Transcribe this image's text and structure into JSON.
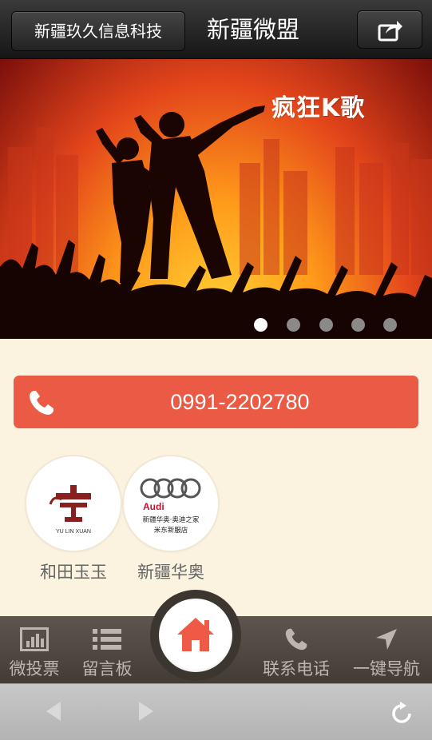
{
  "header": {
    "back_label": "新疆玖久信息科技",
    "title": "新疆微盟"
  },
  "banner": {
    "logo_text": "疯狂K歌",
    "slide_count": 5,
    "active_slide": 1
  },
  "contact": {
    "phone": "0991-2202780"
  },
  "partners": [
    {
      "name": "和田玉玉",
      "logo_caption": "YU LIN XUAN"
    },
    {
      "name": "新疆华奥",
      "logo_brand": "Audi",
      "logo_caption_1": "新疆华奥·奥迪之家",
      "logo_caption_2": "米东新服店"
    }
  ],
  "bottom_nav": {
    "items": [
      {
        "label": "微投票",
        "icon": "chart-icon"
      },
      {
        "label": "留言板",
        "icon": "list-icon"
      },
      {
        "label": "联系电话",
        "icon": "phone-icon"
      },
      {
        "label": "一键导航",
        "icon": "navigation-arrow-icon"
      }
    ],
    "home_icon": "home-icon"
  },
  "browser_bar": {
    "icons": [
      "back-arrow-icon",
      "forward-arrow-icon",
      "refresh-icon"
    ]
  },
  "colors": {
    "accent": "#ea5a44",
    "page_bg": "#fbf3df",
    "nav_bg": "#4f4741"
  }
}
